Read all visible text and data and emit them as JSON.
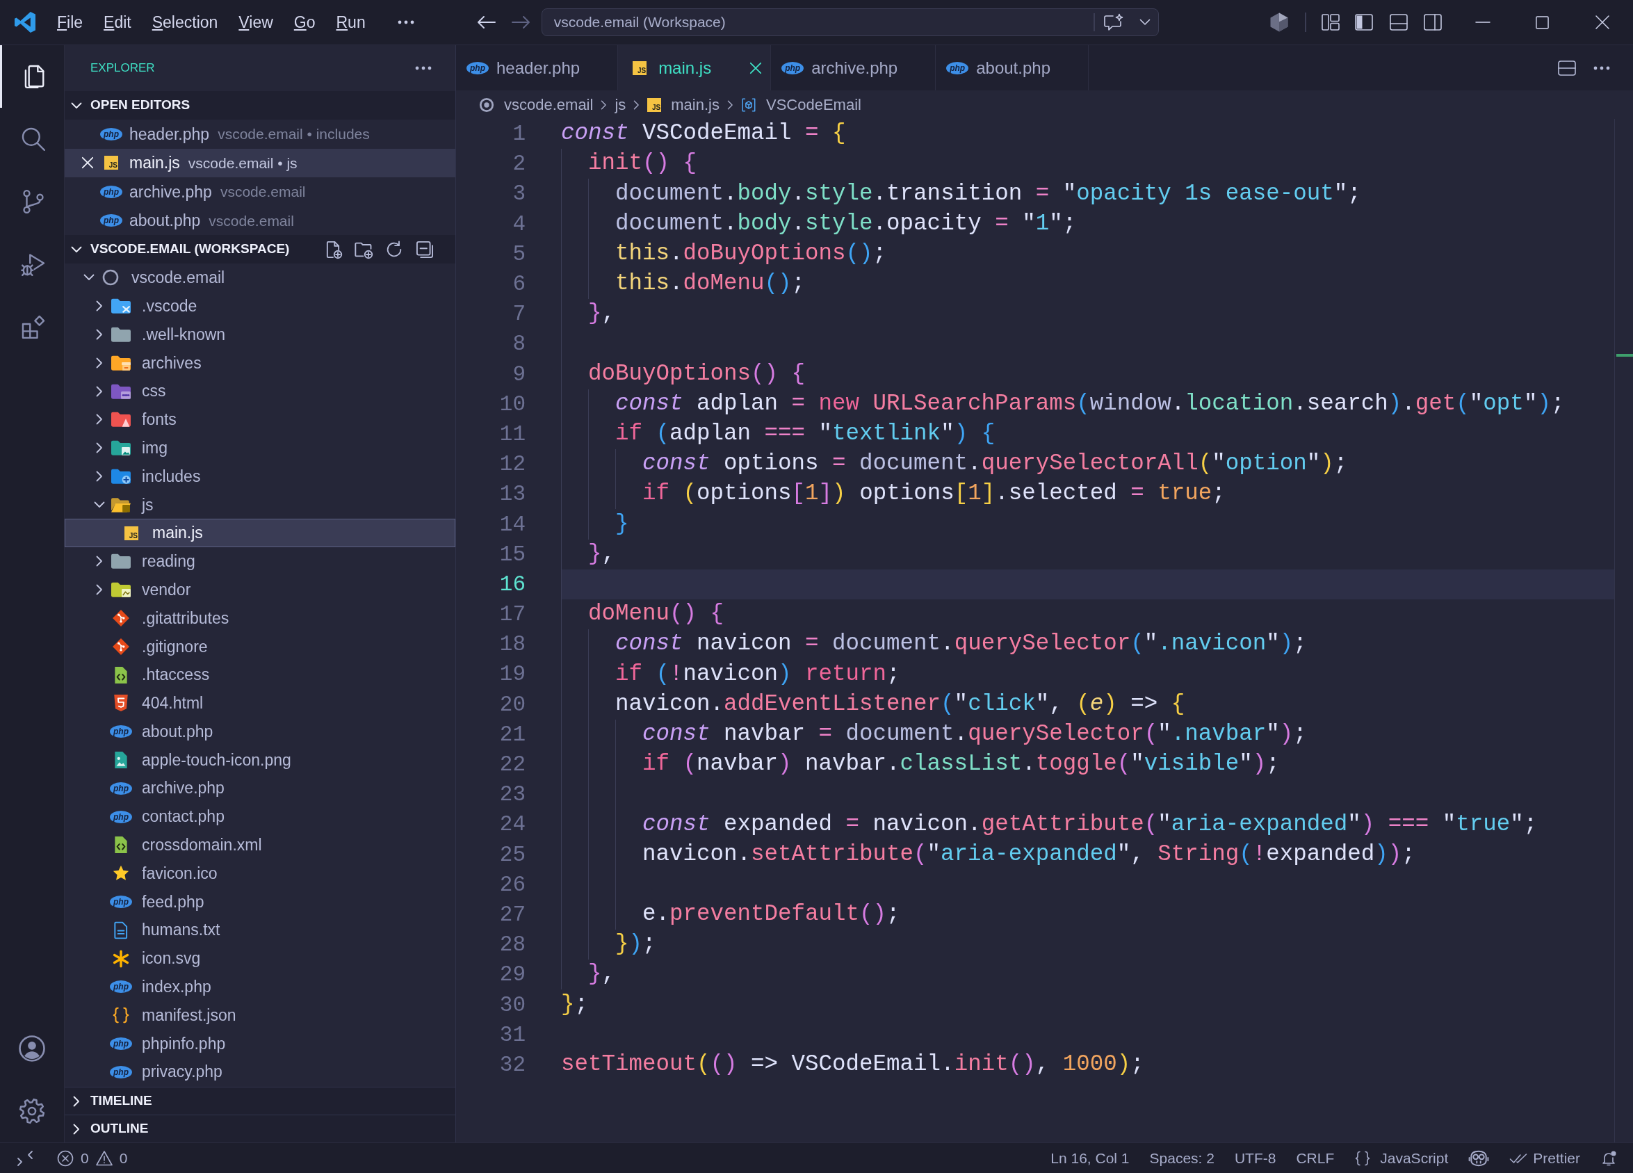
{
  "title_bar": {
    "menus": [
      "File",
      "Edit",
      "Selection",
      "View",
      "Go",
      "Run"
    ],
    "navigation": [
      {
        "kind": "back",
        "disabled": false
      },
      {
        "kind": "forward",
        "disabled": true
      }
    ],
    "command_center": "vscode.email (Workspace)",
    "layout_toggles": [
      {
        "kind": "sidebar",
        "on": true
      },
      {
        "kind": "panel",
        "on": false
      },
      {
        "kind": "auxiliary",
        "on": false
      }
    ]
  },
  "activity_bar": {
    "items": [
      {
        "kind": "files",
        "selected": true
      },
      {
        "kind": "search",
        "selected": false
      },
      {
        "kind": "scm",
        "selected": false
      },
      {
        "kind": "debug",
        "selected": false
      },
      {
        "kind": "extensions",
        "selected": false
      }
    ]
  },
  "sidebar": {
    "title": "EXPLORER",
    "open_editors": {
      "label": "OPEN EDITORS",
      "expanded": true,
      "items": [
        {
          "name": "header.php",
          "description": "vscode.email • includes",
          "kind": "php",
          "badge": "php",
          "selected": false
        },
        {
          "name": "main.js",
          "description": "vscode.email • js",
          "kind": "js",
          "badge": "JS",
          "selected": true
        },
        {
          "name": "archive.php",
          "description": "vscode.email",
          "kind": "php",
          "badge": "php",
          "selected": false
        },
        {
          "name": "about.php",
          "description": "vscode.email",
          "kind": "php",
          "badge": "php",
          "selected": false
        }
      ]
    },
    "workspace": {
      "label": "VSCODE.EMAIL (WORKSPACE)",
      "expanded": true,
      "tree": [
        {
          "name": "vscode.email",
          "kind": "root",
          "expanded": true,
          "selected": false,
          "children": [
            {
              "name": ".vscode",
              "kind": "vscodefolder",
              "expanded": false,
              "selected": false
            },
            {
              "name": ".well-known",
              "kind": "plainfolder",
              "expanded": false,
              "selected": false
            },
            {
              "name": "archives",
              "kind": "archivefolder",
              "expanded": false,
              "selected": false
            },
            {
              "name": "css",
              "kind": "cssfolder",
              "expanded": false,
              "selected": false
            },
            {
              "name": "fonts",
              "kind": "fontfolder",
              "expanded": false,
              "selected": false
            },
            {
              "name": "img",
              "kind": "imagefolder",
              "expanded": false,
              "selected": false
            },
            {
              "name": "includes",
              "kind": "includefolder",
              "expanded": false,
              "selected": false
            },
            {
              "name": "js",
              "kind": "jsfolder",
              "expanded": true,
              "selected": false,
              "children": [
                {
                  "name": "main.js",
                  "kind": "js",
                  "badge": "JS",
                  "selected": true
                }
              ]
            },
            {
              "name": "reading",
              "kind": "plainfolder",
              "expanded": false,
              "selected": false
            },
            {
              "name": "vendor",
              "kind": "vendorfolder",
              "expanded": false,
              "selected": false
            },
            {
              "name": ".gitattributes",
              "kind": "git",
              "selected": false
            },
            {
              "name": ".gitignore",
              "kind": "git",
              "selected": false
            },
            {
              "name": ".htaccess",
              "kind": "code",
              "selected": false
            },
            {
              "name": "404.html",
              "kind": "html",
              "selected": false
            },
            {
              "name": "about.php",
              "kind": "php",
              "badge": "php",
              "selected": false
            },
            {
              "name": "apple-touch-icon.png",
              "kind": "image",
              "selected": false
            },
            {
              "name": "archive.php",
              "kind": "php",
              "badge": "php",
              "selected": false
            },
            {
              "name": "contact.php",
              "kind": "php",
              "badge": "php",
              "selected": false
            },
            {
              "name": "crossdomain.xml",
              "kind": "code",
              "selected": false
            },
            {
              "name": "favicon.ico",
              "kind": "star",
              "selected": false
            },
            {
              "name": "feed.php",
              "kind": "php",
              "badge": "php",
              "selected": false
            },
            {
              "name": "humans.txt",
              "kind": "text",
              "selected": false
            },
            {
              "name": "icon.svg",
              "kind": "asterisk",
              "selected": false
            },
            {
              "name": "index.php",
              "kind": "php",
              "badge": "php",
              "selected": false
            },
            {
              "name": "manifest.json",
              "kind": "json",
              "selected": false
            },
            {
              "name": "phpinfo.php",
              "kind": "php",
              "badge": "php",
              "selected": false
            },
            {
              "name": "privacy.php",
              "kind": "php",
              "badge": "php",
              "selected": false
            }
          ]
        }
      ]
    },
    "panels": [
      {
        "label": "TIMELINE",
        "expanded": false
      },
      {
        "label": "OUTLINE",
        "expanded": false
      }
    ]
  },
  "editor": {
    "tabs": [
      {
        "label": "header.php",
        "kind": "php",
        "badge": "php",
        "selected": false
      },
      {
        "label": "main.js",
        "kind": "js",
        "badge": "JS",
        "selected": true
      },
      {
        "label": "archive.php",
        "kind": "php",
        "badge": "php",
        "selected": false
      },
      {
        "label": "about.php",
        "kind": "php",
        "badge": "php",
        "selected": false
      }
    ],
    "breadcrumbs": [
      {
        "kind": "root",
        "label": "vscode.email"
      },
      {
        "kind": "folder",
        "label": "js"
      },
      {
        "kind": "js",
        "badge": "JS",
        "label": "main.js"
      },
      {
        "kind": "symbol",
        "label": "VSCodeEmail"
      }
    ],
    "lines": [
      {
        "number": "1",
        "current": false,
        "tokens": [
          {
            "kind": "keyword",
            "text": "const"
          },
          {
            "kind": "plain",
            "text": " VSCodeEmail "
          },
          {
            "kind": "operator",
            "text": "= "
          },
          {
            "kind": "gold",
            "text": "{"
          }
        ]
      },
      {
        "number": "2",
        "current": false,
        "tokens": [
          {
            "kind": "function",
            "text": "  init"
          },
          {
            "kind": "orchid",
            "text": "() {"
          }
        ]
      },
      {
        "number": "3",
        "current": false,
        "tokens": [
          {
            "kind": "global",
            "text": "    document"
          },
          {
            "kind": "plain",
            "text": "."
          },
          {
            "kind": "property",
            "text": "body"
          },
          {
            "kind": "plain",
            "text": "."
          },
          {
            "kind": "property",
            "text": "style"
          },
          {
            "kind": "plain",
            "text": ".transition "
          },
          {
            "kind": "operator",
            "text": "="
          },
          {
            "kind": "plain",
            "text": " \""
          },
          {
            "kind": "string",
            "text": "opacity 1s ease-out"
          },
          {
            "kind": "plain",
            "text": "\";"
          }
        ]
      },
      {
        "number": "4",
        "current": false,
        "tokens": [
          {
            "kind": "global",
            "text": "    document"
          },
          {
            "kind": "plain",
            "text": "."
          },
          {
            "kind": "property",
            "text": "body"
          },
          {
            "kind": "plain",
            "text": "."
          },
          {
            "kind": "property",
            "text": "style"
          },
          {
            "kind": "plain",
            "text": ".opacity "
          },
          {
            "kind": "operator",
            "text": "="
          },
          {
            "kind": "plain",
            "text": " \""
          },
          {
            "kind": "string",
            "text": "1"
          },
          {
            "kind": "plain",
            "text": "\";"
          }
        ]
      },
      {
        "number": "5",
        "current": false,
        "tokens": [
          {
            "kind": "self",
            "text": "    this"
          },
          {
            "kind": "plain",
            "text": "."
          },
          {
            "kind": "function",
            "text": "doBuyOptions"
          },
          {
            "kind": "azure",
            "text": "()"
          },
          {
            "kind": "plain",
            "text": ";"
          }
        ]
      },
      {
        "number": "6",
        "current": false,
        "tokens": [
          {
            "kind": "self",
            "text": "    this"
          },
          {
            "kind": "plain",
            "text": "."
          },
          {
            "kind": "function",
            "text": "doMenu"
          },
          {
            "kind": "azure",
            "text": "()"
          },
          {
            "kind": "plain",
            "text": ";"
          }
        ]
      },
      {
        "number": "7",
        "current": false,
        "tokens": [
          {
            "kind": "orchid",
            "text": "  }"
          },
          {
            "kind": "plain",
            "text": ","
          }
        ]
      },
      {
        "number": "8",
        "current": false
      },
      {
        "number": "9",
        "current": false,
        "tokens": [
          {
            "kind": "function",
            "text": "  doBuyOptions"
          },
          {
            "kind": "orchid",
            "text": "() {"
          }
        ]
      },
      {
        "number": "10",
        "current": false,
        "tokens": [
          {
            "kind": "keyword",
            "text": "    const"
          },
          {
            "kind": "plain",
            "text": " adplan "
          },
          {
            "kind": "operator",
            "text": "= "
          },
          {
            "kind": "control",
            "text": "new "
          },
          {
            "kind": "function",
            "text": "URLSearchParams"
          },
          {
            "kind": "azure",
            "text": "("
          },
          {
            "kind": "global",
            "text": "window"
          },
          {
            "kind": "plain",
            "text": "."
          },
          {
            "kind": "property",
            "text": "location"
          },
          {
            "kind": "plain",
            "text": ".search"
          },
          {
            "kind": "azure",
            "text": ")"
          },
          {
            "kind": "plain",
            "text": "."
          },
          {
            "kind": "function",
            "text": "get"
          },
          {
            "kind": "azure",
            "text": "("
          },
          {
            "kind": "plain",
            "text": "\""
          },
          {
            "kind": "string",
            "text": "opt"
          },
          {
            "kind": "plain",
            "text": "\""
          },
          {
            "kind": "azure",
            "text": ")"
          },
          {
            "kind": "plain",
            "text": ";"
          }
        ]
      },
      {
        "number": "11",
        "current": false,
        "tokens": [
          {
            "kind": "control",
            "text": "    if "
          },
          {
            "kind": "azure",
            "text": "("
          },
          {
            "kind": "plain",
            "text": "adplan "
          },
          {
            "kind": "operator",
            "text": "==="
          },
          {
            "kind": "plain",
            "text": " \""
          },
          {
            "kind": "string",
            "text": "textlink"
          },
          {
            "kind": "plain",
            "text": "\""
          },
          {
            "kind": "azure",
            "text": ") {"
          }
        ]
      },
      {
        "number": "12",
        "current": false,
        "tokens": [
          {
            "kind": "keyword",
            "text": "      const"
          },
          {
            "kind": "plain",
            "text": " options "
          },
          {
            "kind": "operator",
            "text": "= "
          },
          {
            "kind": "global",
            "text": "document"
          },
          {
            "kind": "plain",
            "text": "."
          },
          {
            "kind": "function",
            "text": "querySelectorAll"
          },
          {
            "kind": "gold",
            "text": "("
          },
          {
            "kind": "plain",
            "text": "\""
          },
          {
            "kind": "string",
            "text": "option"
          },
          {
            "kind": "plain",
            "text": "\""
          },
          {
            "kind": "gold",
            "text": ")"
          },
          {
            "kind": "plain",
            "text": ";"
          }
        ]
      },
      {
        "number": "13",
        "current": false,
        "tokens": [
          {
            "kind": "control",
            "text": "      if "
          },
          {
            "kind": "gold",
            "text": "("
          },
          {
            "kind": "plain",
            "text": "options"
          },
          {
            "kind": "orchid",
            "text": "["
          },
          {
            "kind": "number",
            "text": "1"
          },
          {
            "kind": "orchid",
            "text": "]"
          },
          {
            "kind": "gold",
            "text": ")"
          },
          {
            "kind": "plain",
            "text": " options"
          },
          {
            "kind": "gold",
            "text": "["
          },
          {
            "kind": "number",
            "text": "1"
          },
          {
            "kind": "gold",
            "text": "]"
          },
          {
            "kind": "plain",
            "text": ".selected "
          },
          {
            "kind": "operator",
            "text": "= "
          },
          {
            "kind": "number",
            "text": "true"
          },
          {
            "kind": "plain",
            "text": ";"
          }
        ]
      },
      {
        "number": "14",
        "current": false,
        "tokens": [
          {
            "kind": "azure",
            "text": "    }"
          }
        ]
      },
      {
        "number": "15",
        "current": false,
        "tokens": [
          {
            "kind": "orchid",
            "text": "  }"
          },
          {
            "kind": "plain",
            "text": ","
          }
        ]
      },
      {
        "number": "16",
        "current": true
      },
      {
        "number": "17",
        "current": false,
        "tokens": [
          {
            "kind": "function",
            "text": "  doMenu"
          },
          {
            "kind": "orchid",
            "text": "() {"
          }
        ]
      },
      {
        "number": "18",
        "current": false,
        "tokens": [
          {
            "kind": "keyword",
            "text": "    const"
          },
          {
            "kind": "plain",
            "text": " navicon "
          },
          {
            "kind": "operator",
            "text": "= "
          },
          {
            "kind": "global",
            "text": "document"
          },
          {
            "kind": "plain",
            "text": "."
          },
          {
            "kind": "function",
            "text": "querySelector"
          },
          {
            "kind": "azure",
            "text": "("
          },
          {
            "kind": "plain",
            "text": "\""
          },
          {
            "kind": "string",
            "text": ".navicon"
          },
          {
            "kind": "plain",
            "text": "\""
          },
          {
            "kind": "azure",
            "text": ")"
          },
          {
            "kind": "plain",
            "text": ";"
          }
        ]
      },
      {
        "number": "19",
        "current": false,
        "tokens": [
          {
            "kind": "control",
            "text": "    if "
          },
          {
            "kind": "azure",
            "text": "("
          },
          {
            "kind": "operator",
            "text": "!"
          },
          {
            "kind": "plain",
            "text": "navicon"
          },
          {
            "kind": "azure",
            "text": ") "
          },
          {
            "kind": "control",
            "text": "return"
          },
          {
            "kind": "plain",
            "text": ";"
          }
        ]
      },
      {
        "number": "20",
        "current": false,
        "tokens": [
          {
            "kind": "plain",
            "text": "    navicon."
          },
          {
            "kind": "function",
            "text": "addEventListener"
          },
          {
            "kind": "azure",
            "text": "("
          },
          {
            "kind": "plain",
            "text": "\""
          },
          {
            "kind": "string",
            "text": "click"
          },
          {
            "kind": "plain",
            "text": "\", "
          },
          {
            "kind": "gold",
            "text": "("
          },
          {
            "kind": "param",
            "text": "e"
          },
          {
            "kind": "gold",
            "text": ")"
          },
          {
            "kind": "plain",
            "text": " => "
          },
          {
            "kind": "gold",
            "text": "{"
          }
        ]
      },
      {
        "number": "21",
        "current": false,
        "tokens": [
          {
            "kind": "keyword",
            "text": "      const"
          },
          {
            "kind": "plain",
            "text": " navbar "
          },
          {
            "kind": "operator",
            "text": "= "
          },
          {
            "kind": "global",
            "text": "document"
          },
          {
            "kind": "plain",
            "text": "."
          },
          {
            "kind": "function",
            "text": "querySelector"
          },
          {
            "kind": "orchid",
            "text": "("
          },
          {
            "kind": "plain",
            "text": "\""
          },
          {
            "kind": "string",
            "text": ".navbar"
          },
          {
            "kind": "plain",
            "text": "\""
          },
          {
            "kind": "orchid",
            "text": ")"
          },
          {
            "kind": "plain",
            "text": ";"
          }
        ]
      },
      {
        "number": "22",
        "current": false,
        "tokens": [
          {
            "kind": "control",
            "text": "      if "
          },
          {
            "kind": "orchid",
            "text": "("
          },
          {
            "kind": "plain",
            "text": "navbar"
          },
          {
            "kind": "orchid",
            "text": ")"
          },
          {
            "kind": "plain",
            "text": " navbar."
          },
          {
            "kind": "property",
            "text": "classList"
          },
          {
            "kind": "plain",
            "text": "."
          },
          {
            "kind": "function",
            "text": "toggle"
          },
          {
            "kind": "orchid",
            "text": "("
          },
          {
            "kind": "plain",
            "text": "\""
          },
          {
            "kind": "string",
            "text": "visible"
          },
          {
            "kind": "plain",
            "text": "\""
          },
          {
            "kind": "orchid",
            "text": ")"
          },
          {
            "kind": "plain",
            "text": ";"
          }
        ]
      },
      {
        "number": "23",
        "current": false
      },
      {
        "number": "24",
        "current": false,
        "tokens": [
          {
            "kind": "keyword",
            "text": "      const"
          },
          {
            "kind": "plain",
            "text": " expanded "
          },
          {
            "kind": "operator",
            "text": "="
          },
          {
            "kind": "plain",
            "text": " navicon."
          },
          {
            "kind": "function",
            "text": "getAttribute"
          },
          {
            "kind": "orchid",
            "text": "("
          },
          {
            "kind": "plain",
            "text": "\""
          },
          {
            "kind": "string",
            "text": "aria-expanded"
          },
          {
            "kind": "plain",
            "text": "\""
          },
          {
            "kind": "orchid",
            "text": ") "
          },
          {
            "kind": "operator",
            "text": "==="
          },
          {
            "kind": "plain",
            "text": " \""
          },
          {
            "kind": "string",
            "text": "true"
          },
          {
            "kind": "plain",
            "text": "\";"
          }
        ]
      },
      {
        "number": "25",
        "current": false,
        "tokens": [
          {
            "kind": "plain",
            "text": "      navicon."
          },
          {
            "kind": "function",
            "text": "setAttribute"
          },
          {
            "kind": "orchid",
            "text": "("
          },
          {
            "kind": "plain",
            "text": "\""
          },
          {
            "kind": "string",
            "text": "aria-expanded"
          },
          {
            "kind": "plain",
            "text": "\", "
          },
          {
            "kind": "function",
            "text": "String"
          },
          {
            "kind": "azure",
            "text": "("
          },
          {
            "kind": "operator",
            "text": "!"
          },
          {
            "kind": "plain",
            "text": "expanded"
          },
          {
            "kind": "azure",
            "text": ")"
          },
          {
            "kind": "orchid",
            "text": ")"
          },
          {
            "kind": "plain",
            "text": ";"
          }
        ]
      },
      {
        "number": "26",
        "current": false
      },
      {
        "number": "27",
        "current": false,
        "tokens": [
          {
            "kind": "plain",
            "text": "      e."
          },
          {
            "kind": "function",
            "text": "preventDefault"
          },
          {
            "kind": "orchid",
            "text": "()"
          },
          {
            "kind": "plain",
            "text": ";"
          }
        ]
      },
      {
        "number": "28",
        "current": false,
        "tokens": [
          {
            "kind": "gold",
            "text": "    }"
          },
          {
            "kind": "azure",
            "text": ")"
          },
          {
            "kind": "plain",
            "text": ";"
          }
        ]
      },
      {
        "number": "29",
        "current": false,
        "tokens": [
          {
            "kind": "orchid",
            "text": "  }"
          },
          {
            "kind": "plain",
            "text": ","
          }
        ]
      },
      {
        "number": "30",
        "current": false,
        "tokens": [
          {
            "kind": "gold",
            "text": "}"
          },
          {
            "kind": "plain",
            "text": ";"
          }
        ]
      },
      {
        "number": "31",
        "current": false
      },
      {
        "number": "32",
        "current": false,
        "tokens": [
          {
            "kind": "function",
            "text": "setTimeout"
          },
          {
            "kind": "gold",
            "text": "("
          },
          {
            "kind": "orchid",
            "text": "()"
          },
          {
            "kind": "plain",
            "text": " => VSCodeEmail."
          },
          {
            "kind": "function",
            "text": "init"
          },
          {
            "kind": "orchid",
            "text": "()"
          },
          {
            "kind": "plain",
            "text": ", "
          },
          {
            "kind": "number",
            "text": "1000"
          },
          {
            "kind": "gold",
            "text": ")"
          },
          {
            "kind": "plain",
            "text": ";"
          }
        ]
      }
    ]
  },
  "status_bar": {
    "problems": {
      "errors": "0",
      "warnings": "0"
    },
    "items": [
      {
        "kind": "text",
        "text": "Ln 16, Col 1"
      },
      {
        "kind": "text",
        "text": "Spaces: 2"
      },
      {
        "kind": "text",
        "text": "UTF-8"
      },
      {
        "kind": "text",
        "text": "CRLF"
      },
      {
        "kind": "language",
        "text": "JavaScript"
      },
      {
        "kind": "copilot"
      },
      {
        "kind": "formatter",
        "text": "Prettier"
      },
      {
        "kind": "notifications"
      }
    ]
  }
}
